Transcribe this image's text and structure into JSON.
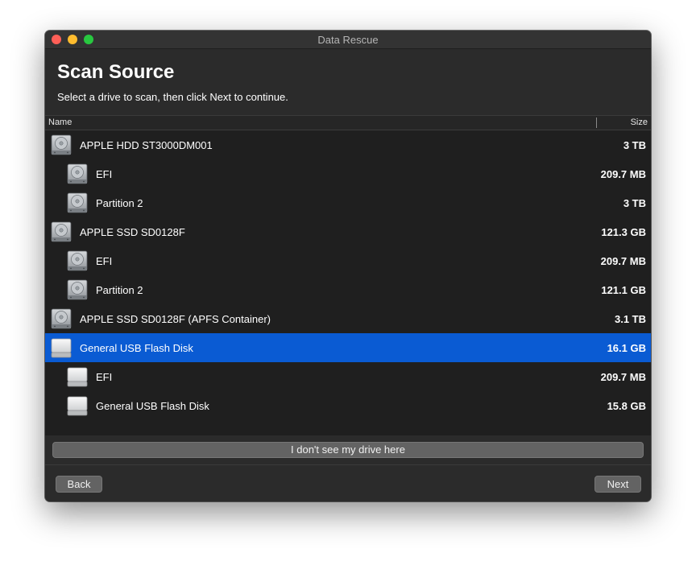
{
  "window": {
    "title": "Data Rescue"
  },
  "header": {
    "title": "Scan Source",
    "subtitle": "Select a drive to scan, then click Next to continue."
  },
  "list": {
    "columns": {
      "name": "Name",
      "size": "Size"
    },
    "rows": [
      {
        "label": "APPLE HDD ST3000DM001",
        "size": "3 TB",
        "level": 0,
        "icon": "internal-drive-icon",
        "selected": false
      },
      {
        "label": "EFI",
        "size": "209.7 MB",
        "level": 1,
        "icon": "internal-drive-icon",
        "selected": false
      },
      {
        "label": "Partition 2",
        "size": "3 TB",
        "level": 1,
        "icon": "internal-drive-icon",
        "selected": false
      },
      {
        "label": "APPLE SSD SD0128F",
        "size": "121.3 GB",
        "level": 0,
        "icon": "internal-drive-icon",
        "selected": false
      },
      {
        "label": "EFI",
        "size": "209.7 MB",
        "level": 1,
        "icon": "internal-drive-icon",
        "selected": false
      },
      {
        "label": "Partition 2",
        "size": "121.1 GB",
        "level": 1,
        "icon": "internal-drive-icon",
        "selected": false
      },
      {
        "label": "APPLE SSD SD0128F (APFS Container)",
        "size": "3.1 TB",
        "level": 0,
        "icon": "internal-drive-icon",
        "selected": false
      },
      {
        "label": "General USB Flash Disk",
        "size": "16.1 GB",
        "level": 0,
        "icon": "external-drive-icon",
        "selected": true
      },
      {
        "label": "EFI",
        "size": "209.7 MB",
        "level": 1,
        "icon": "external-drive-icon",
        "selected": false
      },
      {
        "label": "General USB Flash Disk",
        "size": "15.8 GB",
        "level": 1,
        "icon": "external-drive-icon",
        "selected": false
      }
    ]
  },
  "actions": {
    "cant_see_label": "I don't see my drive here",
    "back_label": "Back",
    "next_label": "Next"
  },
  "colors": {
    "selection": "#0a5bd3",
    "window_bg": "#2b2b2b",
    "list_bg": "#1f1f1f"
  }
}
